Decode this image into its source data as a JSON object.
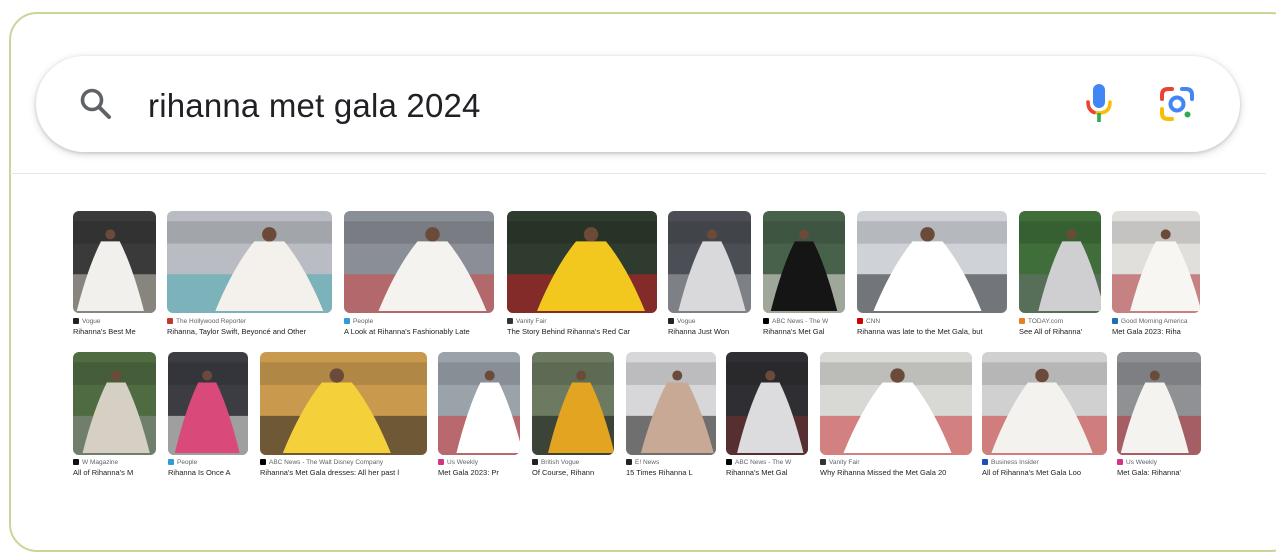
{
  "search": {
    "query": "rihanna met gala 2024",
    "icons": {
      "search": "search-icon",
      "voice": "microphone-icon",
      "lens": "google-lens-icon"
    }
  },
  "colors": {
    "frame_border": "#c5d89a",
    "mic_blue": "#4285f4",
    "mic_red": "#ea4335",
    "mic_yellow": "#fbbc05",
    "mic_green": "#34a853"
  },
  "results": {
    "row1": [
      {
        "source": "Vogue",
        "title": "Rihanna's Best Me",
        "palette": [
          "#3a3a3a",
          "#f2f0ec",
          "#c8c2b8"
        ]
      },
      {
        "source": "The Hollywood Reporter",
        "title": "Rihanna, Taylor Swift, Beyoncé and Other",
        "palette": [
          "#b9bcc2",
          "#f4f1ec",
          "#4aa9b5"
        ]
      },
      {
        "source": "People",
        "title": "A Look at Rihanna's Fashionably Late",
        "palette": [
          "#8a8e96",
          "#f5f3ef",
          "#d54a4a"
        ]
      },
      {
        "source": "Vanity Fair",
        "title": "The Story Behind Rihanna's Red Car",
        "palette": [
          "#2e3b2e",
          "#f2c81e",
          "#c81f25"
        ]
      },
      {
        "source": "Vogue",
        "title": "Rihanna Just Won",
        "palette": [
          "#4b4f55",
          "#d9d9dc",
          "#a7a9ad"
        ]
      },
      {
        "source": "ABC News - The W",
        "title": "Rihanna's Met Gal",
        "palette": [
          "#47614a",
          "#151515",
          "#e6e2da"
        ]
      },
      {
        "source": "CNN",
        "title": "Rihanna was late to the Met Gala, but",
        "palette": [
          "#cfd3d8",
          "#ffffff",
          "#26292e"
        ]
      },
      {
        "source": "TODAY.com",
        "title": "See All of Rihanna'",
        "palette": [
          "#3f6e3a",
          "#cfcfd2",
          "#6b6f73"
        ]
      },
      {
        "source": "Good Morning America",
        "title": "Met Gala 2023: Riha",
        "palette": [
          "#e0dfdc",
          "#f7f6f3",
          "#b0333a"
        ]
      }
    ],
    "row2": [
      {
        "source": "W Magazine",
        "title": "All of Rihanna's M",
        "palette": [
          "#4f6b41",
          "#d6cfc3",
          "#8a8f8e"
        ]
      },
      {
        "source": "People",
        "title": "Rihanna Is Once A",
        "palette": [
          "#3b3d42",
          "#d94a7a",
          "#f1f1f1"
        ]
      },
      {
        "source": "ABC News - The Walt Disney Company",
        "title": "Rihanna's Met Gala dresses: All her past l",
        "palette": [
          "#c99a4e",
          "#f4d03a",
          "#222222"
        ]
      },
      {
        "source": "Us Weekly",
        "title": "Met Gala 2023: Pr",
        "palette": [
          "#9aa2aa",
          "#ffffff",
          "#cf3b3b"
        ]
      },
      {
        "source": "British Vogue",
        "title": "Of Course, Rihann",
        "palette": [
          "#6b7a60",
          "#e3a422",
          "#151515"
        ]
      },
      {
        "source": "E! News",
        "title": "15 Times Rihanna L",
        "palette": [
          "#d7d7da",
          "#c7a995",
          "#1a1a1a"
        ]
      },
      {
        "source": "ABC News - The W",
        "title": "Rihanna's Met Gal",
        "palette": [
          "#2f2f33",
          "#dcdcdf",
          "#7a3030"
        ]
      },
      {
        "source": "Vanity Fair",
        "title": "Why Rihanna Missed the Met Gala 20",
        "palette": [
          "#d8d8d4",
          "#ffffff",
          "#cf3b3b"
        ]
      },
      {
        "source": "Business Insider",
        "title": "All of Rihanna's Met Gala Loo",
        "palette": [
          "#cfd0cf",
          "#f3f2ef",
          "#cf3b3b"
        ]
      },
      {
        "source": "Us Weekly",
        "title": "Met Gala: Rihanna'",
        "palette": [
          "#8f9194",
          "#f4f3f0",
          "#b8343a"
        ]
      }
    ]
  }
}
